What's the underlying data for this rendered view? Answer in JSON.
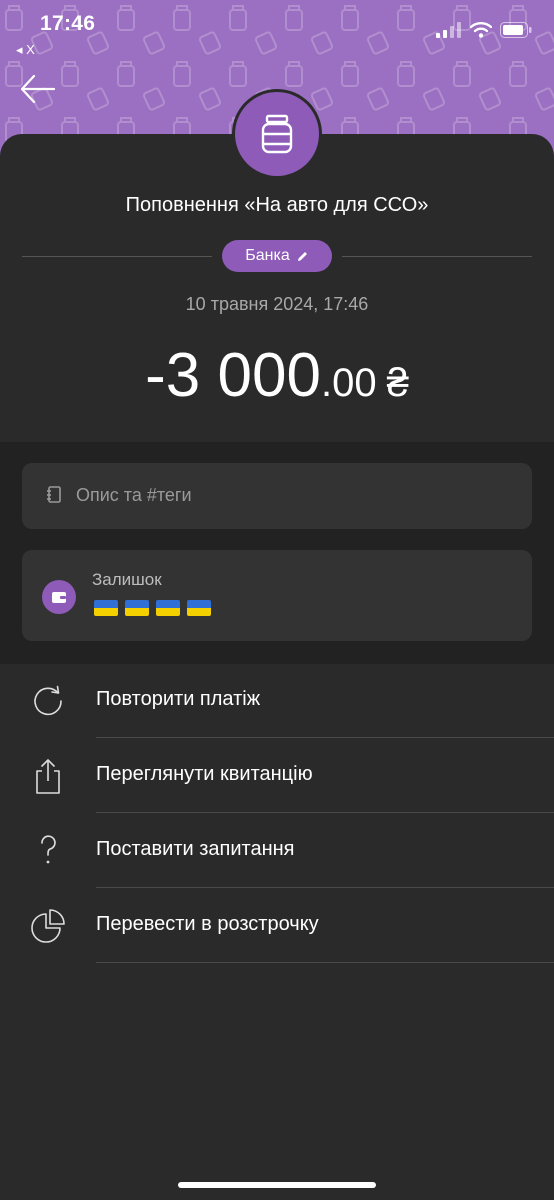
{
  "status_bar": {
    "time": "17:46",
    "back_app": "◂ X"
  },
  "header": {
    "title": "Поповнення «На авто для ССО»"
  },
  "category": {
    "label": "Банка"
  },
  "transaction": {
    "date": "10 травня 2024, 17:46",
    "amount_int": "-3 000",
    "amount_frac": ".00",
    "currency": "₴"
  },
  "description": {
    "placeholder": "Опис та #теги"
  },
  "balance": {
    "label": "Залишок",
    "flag_count": 4
  },
  "actions": [
    {
      "label": "Повторити платіж",
      "icon": "repeat-icon"
    },
    {
      "label": "Переглянути квитанцію",
      "icon": "share-icon"
    },
    {
      "label": "Поставити запитання",
      "icon": "question-icon"
    },
    {
      "label": "Перевести в розстрочку",
      "icon": "pie-chart-icon"
    }
  ],
  "colors": {
    "accent": "#9b6fc1",
    "chip": "#8e5bb8",
    "background": "#2a2a2a"
  }
}
